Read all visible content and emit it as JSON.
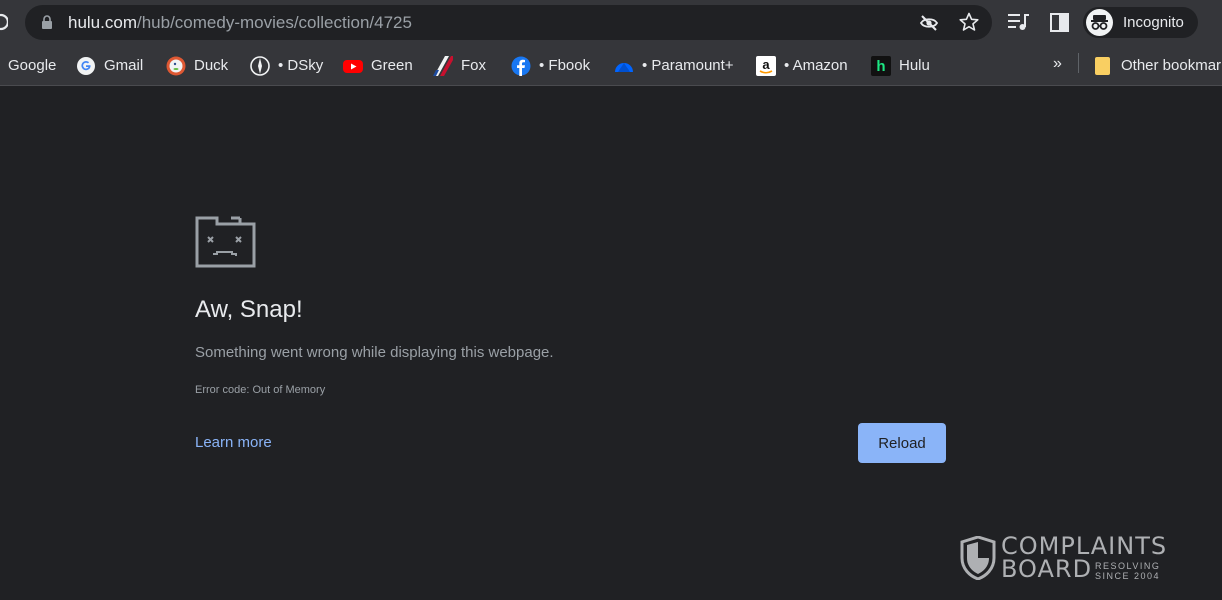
{
  "address_bar": {
    "url_host": "hulu.com",
    "url_path": "/hub/comedy-movies/collection/4725"
  },
  "profile": {
    "label": "Incognito"
  },
  "bookmarks": [
    {
      "label": "Google",
      "icon": "google-icon"
    },
    {
      "label": "Gmail",
      "icon": "google-icon"
    },
    {
      "label": "Duck",
      "icon": "duckduckgo-icon"
    },
    {
      "label": "• DSky",
      "icon": "dsky-icon"
    },
    {
      "label": "Green",
      "icon": "youtube-icon"
    },
    {
      "label": "Fox",
      "icon": "fox-icon"
    },
    {
      "label": "• Fbook",
      "icon": "facebook-icon"
    },
    {
      "label": "• Paramount+",
      "icon": "paramount-icon"
    },
    {
      "label": "• Amazon",
      "icon": "amazon-icon"
    },
    {
      "label": "Hulu",
      "icon": "hulu-icon"
    }
  ],
  "bookmarks_overflow": "»",
  "other_bookmarks": {
    "label": "Other bookmarks",
    "icon": "folder-icon"
  },
  "error_page": {
    "icon": "sad-tab-icon",
    "heading": "Aw, Snap!",
    "message": "Something went wrong while displaying this webpage.",
    "error_code": "Error code: Out of Memory",
    "learn_more": "Learn more",
    "reload_button": "Reload"
  },
  "watermark": {
    "line1": "COMPLAINTS",
    "line2": "BOARD",
    "tagline1": "RESOLVING",
    "tagline2": "SINCE 2004"
  },
  "colors": {
    "page_background": "#202124",
    "toolbar_background": "#35363a",
    "link": "#8ab4f8",
    "button": "#8ab4f8"
  }
}
